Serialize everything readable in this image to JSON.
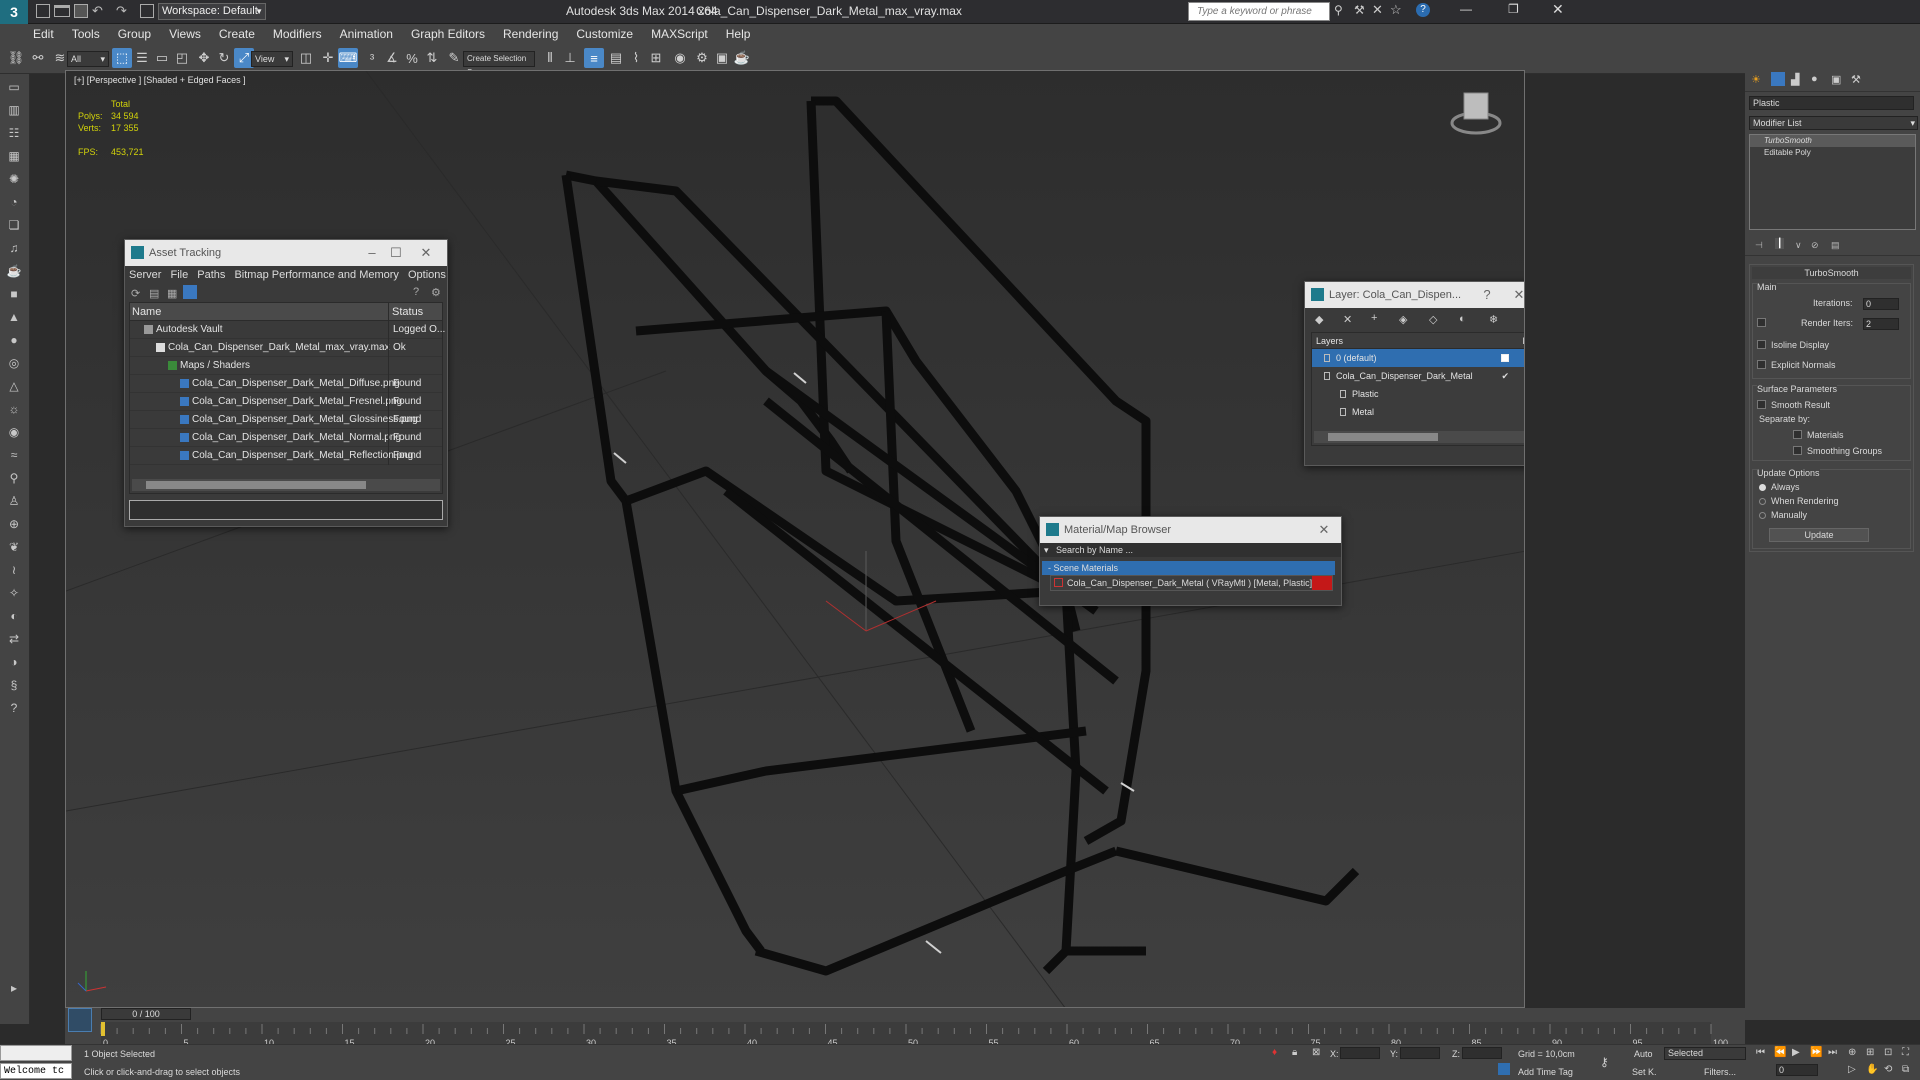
{
  "title": {
    "workspace": "Workspace: Default",
    "app": "Autodesk 3ds Max  2014 x64",
    "file": "Cola_Can_Dispenser_Dark_Metal_max_vray.max",
    "search_placeholder": "Type a keyword or phrase"
  },
  "menu": [
    "Edit",
    "Tools",
    "Group",
    "Views",
    "Create",
    "Modifiers",
    "Animation",
    "Graph Editors",
    "Rendering",
    "Customize",
    "MAXScript",
    "Help"
  ],
  "toolbar": {
    "filter": "All",
    "refcoord": "View",
    "selset": "Create Selection S"
  },
  "viewport": {
    "label": "[+] [Perspective ] [Shaded + Edged Faces ]",
    "stats": {
      "total": "Total",
      "polys_label": "Polys:",
      "polys": "34 594",
      "verts_label": "Verts:",
      "verts": "17 355",
      "fps_label": "FPS:",
      "fps": "453,721"
    }
  },
  "asset_tracking": {
    "title": "Asset Tracking",
    "menu": [
      "Server",
      "File",
      "Paths",
      "Bitmap Performance and Memory",
      "Options"
    ],
    "col_name": "Name",
    "col_status": "Status",
    "rows": [
      {
        "name": "Autodesk Vault",
        "status": "Logged O...",
        "indent": 1,
        "icon": "vault-icon"
      },
      {
        "name": "Cola_Can_Dispenser_Dark_Metal_max_vray.max",
        "status": "Ok",
        "indent": 2,
        "icon": "max-file-icon"
      },
      {
        "name": "Maps / Shaders",
        "status": "",
        "indent": 3,
        "icon": "folder-icon"
      },
      {
        "name": "Cola_Can_Dispenser_Dark_Metal_Diffuse.png",
        "status": "Found",
        "indent": 4,
        "icon": "image-icon"
      },
      {
        "name": "Cola_Can_Dispenser_Dark_Metal_Fresnel.png",
        "status": "Found",
        "indent": 4,
        "icon": "image-icon"
      },
      {
        "name": "Cola_Can_Dispenser_Dark_Metal_Glossiness.png",
        "status": "Found",
        "indent": 4,
        "icon": "image-icon"
      },
      {
        "name": "Cola_Can_Dispenser_Dark_Metal_Normal.png",
        "status": "Found",
        "indent": 4,
        "icon": "image-icon"
      },
      {
        "name": "Cola_Can_Dispenser_Dark_Metal_Reflection.png",
        "status": "Found",
        "indent": 4,
        "icon": "image-icon"
      }
    ]
  },
  "layer_window": {
    "title": "Layer: Cola_Can_Dispen...",
    "header": "Layers",
    "header_h": "H",
    "rows": [
      {
        "name": "0 (default)",
        "selected": true
      },
      {
        "name": "Cola_Can_Dispenser_Dark_Metal",
        "selected": false
      },
      {
        "name": "Plastic",
        "selected": false
      },
      {
        "name": "Metal",
        "selected": false
      }
    ]
  },
  "material_browser": {
    "title": "Material/Map Browser",
    "search": "Search by Name ...",
    "section": "- Scene Materials",
    "item": "Cola_Can_Dispenser_Dark_Metal ( VRayMtl ) [Metal, Plastic]"
  },
  "command_panel": {
    "object_name": "Plastic",
    "modifier_list": "Modifier List",
    "stack": [
      "TurboSmooth",
      "Editable Poly"
    ],
    "rollout": "TurboSmooth",
    "main": "Main",
    "iterations_label": "Iterations:",
    "iterations": "0",
    "render_iters_label": "Render Iters:",
    "render_iters": "2",
    "isoline": "Isoline Display",
    "explicit": "Explicit Normals",
    "surface_params": "Surface Parameters",
    "smooth_result": "Smooth Result",
    "separate_by": "Separate by:",
    "materials": "Materials",
    "smoothing_groups": "Smoothing Groups",
    "update_options": "Update Options",
    "always": "Always",
    "when_rendering": "When Rendering",
    "manually": "Manually",
    "update": "Update"
  },
  "timeline": {
    "frame": "0 / 100",
    "ticks": [
      "0",
      "5",
      "10",
      "15",
      "20",
      "25",
      "30",
      "35",
      "40",
      "45",
      "50",
      "55",
      "60",
      "65",
      "70",
      "75",
      "80",
      "85",
      "90",
      "95",
      "100"
    ]
  },
  "status": {
    "welcome": "Welcome tc",
    "selected": "1 Object Selected",
    "prompt": "Click or click-and-drag to select objects",
    "x": "X:",
    "y": "Y:",
    "z": "Z:",
    "grid": "Grid = 10,0cm",
    "add_time_tag": "Add Time Tag",
    "auto": "Auto",
    "selected_dd": "Selected",
    "setk": "Set K.",
    "filters": "Filters...",
    "frame_field": "0"
  }
}
